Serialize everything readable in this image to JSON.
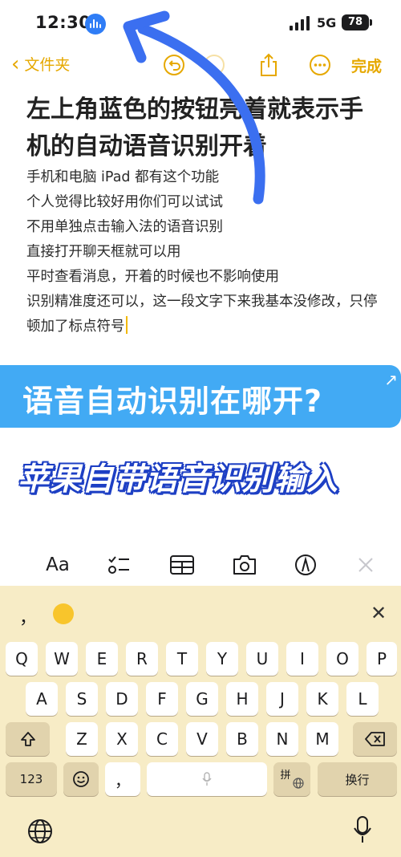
{
  "status_bar": {
    "time": "12:30",
    "network": "5G",
    "battery": "78"
  },
  "nav": {
    "back_label": "文件夹",
    "done_label": "完成"
  },
  "note": {
    "title": "左上角蓝色的按钮亮着就表示手机的自动语音识别开着",
    "lines": [
      "手机和电脑 iPad 都有这个功能",
      "个人觉得比较好用你们可以试试",
      "不用单独点击输入法的语音识别",
      "直接打开聊天框就可以用",
      "平时查看消息，开着的时候也不影响使用",
      "识别精准度还可以，这一段文字下来我基本没修改，只停顿加了标点符号"
    ]
  },
  "banners": {
    "question": "语音自动识别在哪开?",
    "subtitle": "苹果自带语音识别输入"
  },
  "toolbar": {
    "format_label": "Aa"
  },
  "keyboard": {
    "candidates": {
      "comma": "，"
    },
    "row1": [
      "Q",
      "W",
      "E",
      "R",
      "T",
      "Y",
      "U",
      "I",
      "O",
      "P"
    ],
    "row2": [
      "A",
      "S",
      "D",
      "F",
      "G",
      "H",
      "J",
      "K",
      "L"
    ],
    "row3": [
      "Z",
      "X",
      "C",
      "V",
      "B",
      "N",
      "M"
    ],
    "numbers_label": "123",
    "comma_key": "，",
    "input_method_label": "拼",
    "return_label": "换行"
  },
  "colors": {
    "accent": "#e6a800",
    "voice_indicator": "#2f7df6",
    "banner_blue": "#42aaf4",
    "keyboard_bg": "#f7ecc6",
    "annotation_arrow": "#3b6ff0"
  }
}
